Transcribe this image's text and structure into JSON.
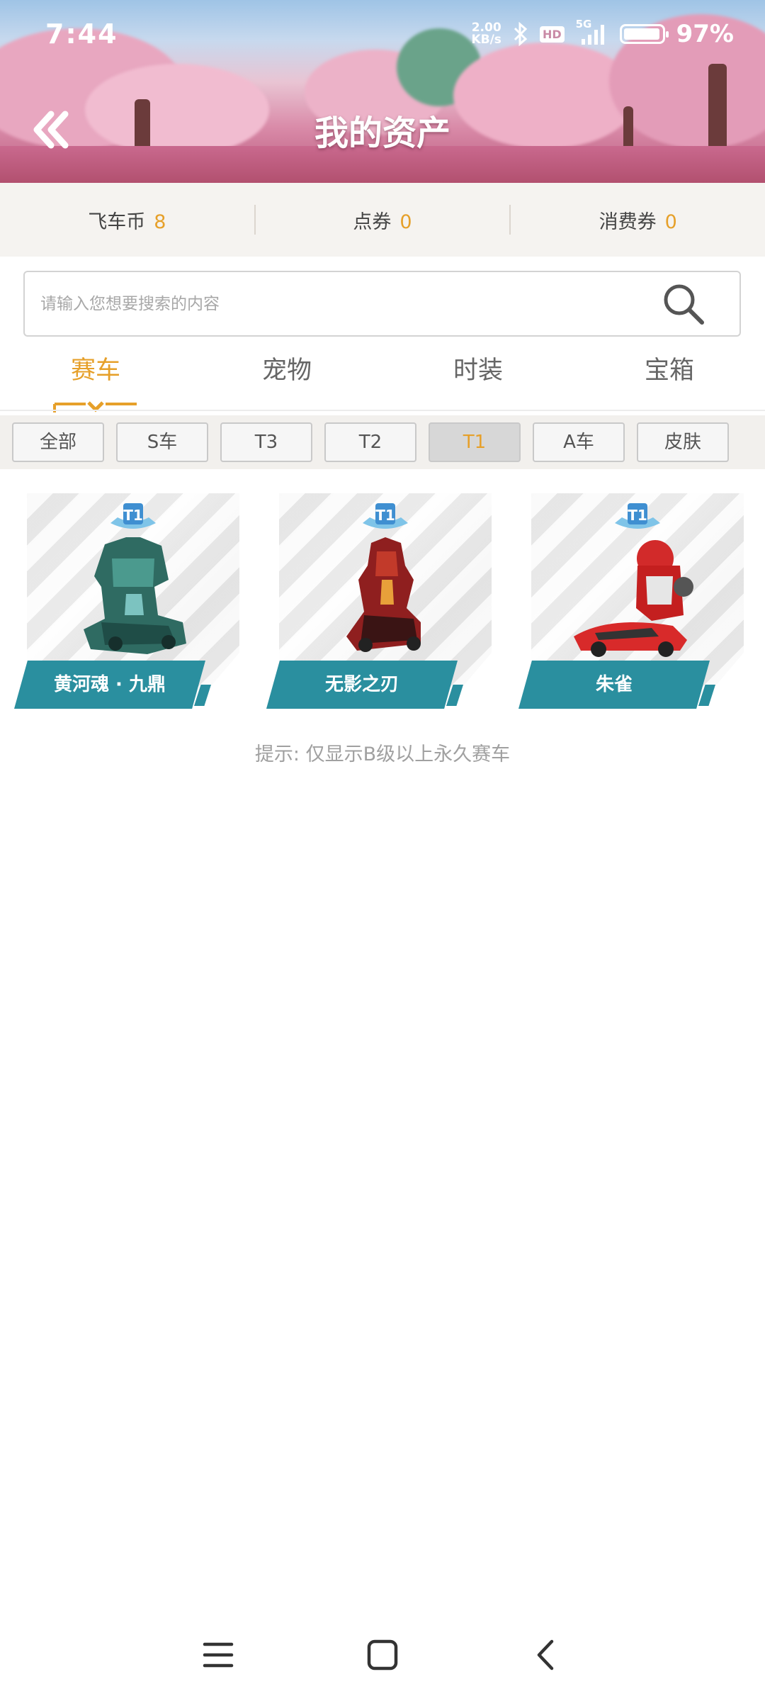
{
  "status_bar": {
    "time": "7:44",
    "net_speed_value": "2.00",
    "net_speed_unit": "KB/s",
    "hd_label": "HD",
    "network_label": "5G",
    "battery_text": "97%",
    "battery_level": 0.97
  },
  "header": {
    "title": "我的资产",
    "back_icon": "double-chevron-left-icon"
  },
  "currencies": [
    {
      "label": "飞车币",
      "value": "8"
    },
    {
      "label": "点券",
      "value": "0"
    },
    {
      "label": "消费券",
      "value": "0"
    }
  ],
  "search": {
    "placeholder": "请输入您想要搜索的内容",
    "value": "",
    "icon": "search-icon"
  },
  "tabs": [
    {
      "label": "赛车",
      "active": true
    },
    {
      "label": "宠物",
      "active": false
    },
    {
      "label": "时装",
      "active": false
    },
    {
      "label": "宝箱",
      "active": false
    }
  ],
  "filters": [
    {
      "label": "全部",
      "active": false
    },
    {
      "label": "S车",
      "active": false
    },
    {
      "label": "T3",
      "active": false
    },
    {
      "label": "T2",
      "active": false
    },
    {
      "label": "T1",
      "active": true
    },
    {
      "label": "A车",
      "active": false
    },
    {
      "label": "皮肤",
      "active": false
    }
  ],
  "cars": [
    {
      "name": "黄河魂 · 九鼎",
      "tier": "T1",
      "color": "#2f6b62"
    },
    {
      "name": "无影之刃",
      "tier": "T1",
      "color": "#8f1f1f"
    },
    {
      "name": "朱雀",
      "tier": "T1",
      "color": "#d22a2a"
    }
  ],
  "hint": "提示: 仅显示B级以上永久赛车",
  "colors": {
    "accent": "#e6a02a",
    "plate": "#2a8f9f"
  },
  "navbar": {
    "menu_icon": "menu-icon",
    "home_icon": "home-square-icon",
    "back_icon": "back-chevron-icon"
  }
}
